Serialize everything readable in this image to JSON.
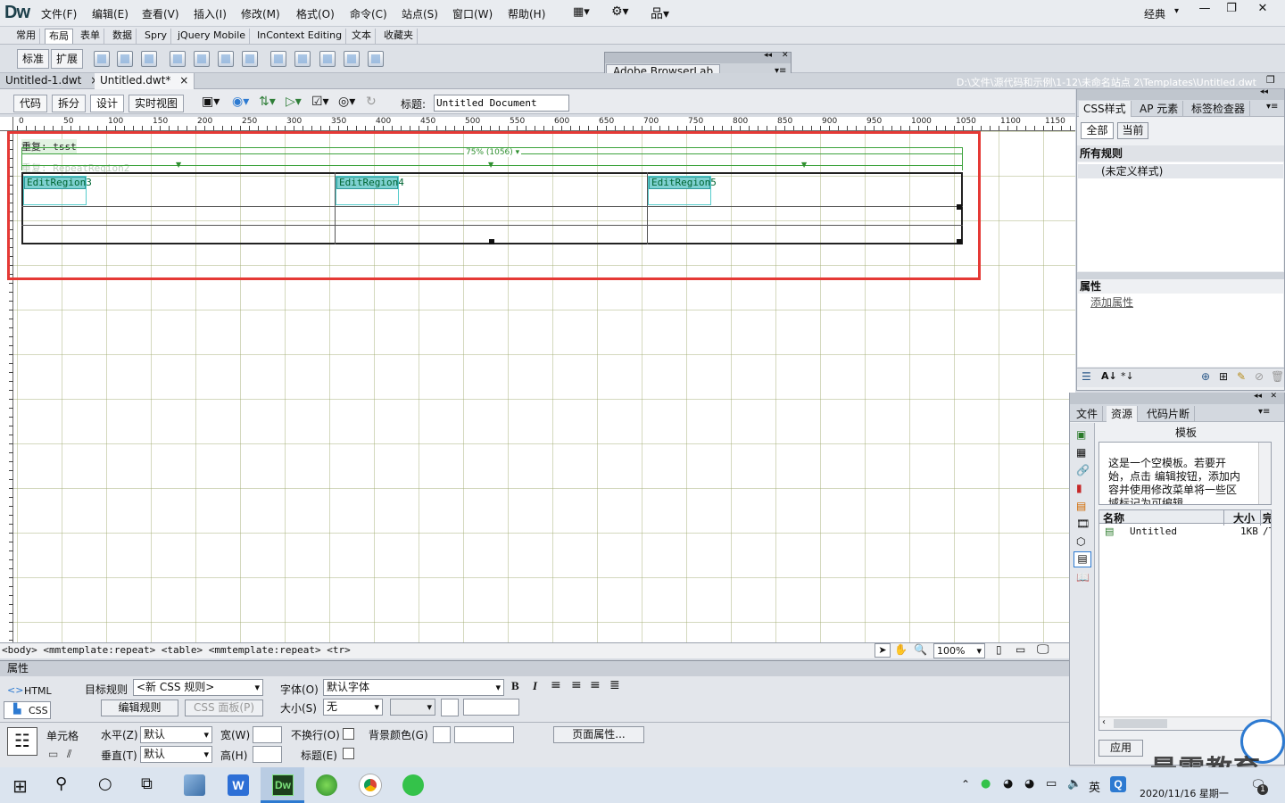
{
  "app": {
    "logo": "Dw",
    "workspace": "经典"
  },
  "menu": [
    "文件(F)",
    "编辑(E)",
    "查看(V)",
    "插入(I)",
    "修改(M)",
    "格式(O)",
    "命令(C)",
    "站点(S)",
    "窗口(W)",
    "帮助(H)"
  ],
  "insert_tabs": [
    "常用",
    "布局",
    "表单",
    "数据",
    "Spry",
    "jQuery Mobile",
    "InContext Editing",
    "文本",
    "收藏夹"
  ],
  "insert_active": "布局",
  "layout_buttons": {
    "standard": "标准",
    "expanded": "扩展"
  },
  "browserlab": "Adobe BrowserLab",
  "doc_tabs": [
    {
      "label": "Untitled-1.dwt",
      "close": "×"
    },
    {
      "label": "Untitled.dwt*",
      "close": "×"
    }
  ],
  "doc_path": "D:\\文件\\源代码和示例\\1-12\\未命名站点 2\\Templates\\Untitled.dwt",
  "view_buttons": [
    "代码",
    "拆分",
    "设计",
    "实时视图"
  ],
  "active_view": "设计",
  "title_label": "标题:",
  "title_value": "Untitled Document",
  "ruler_ticks": [
    "0",
    "50",
    "100",
    "150",
    "200",
    "250",
    "300",
    "350",
    "400",
    "450",
    "500",
    "550",
    "600",
    "650",
    "700",
    "750",
    "800",
    "850",
    "900",
    "950",
    "1000",
    "1050",
    "1100",
    "1150"
  ],
  "design": {
    "repeat_label": "重复: tsst",
    "repeat_region": "重复: RepeatRegion2",
    "width_label": "75% (1056) ▾",
    "edit_regions": [
      "EditRegion3",
      "EditRegion4",
      "EditRegion5"
    ]
  },
  "tag_selector": "<body> <mmtemplate:repeat> <table> <mmtemplate:repeat> <tr>",
  "zoom": "100%",
  "properties": {
    "header": "属性",
    "html": "HTML",
    "css": "CSS",
    "target_rule_label": "目标规则",
    "target_rule_value": "<新 CSS 规则>",
    "edit_rule": "编辑规则",
    "css_panel": "CSS 面板(P)",
    "font_label": "字体(O)",
    "font_value": "默认字体",
    "size_label": "大小(S)",
    "size_value": "无",
    "bold": "B",
    "italic": "I",
    "cell_label": "单元格",
    "horz_label": "水平(Z)",
    "horz_value": "默认",
    "vert_label": "垂直(T)",
    "vert_value": "默认",
    "width_label": "宽(W)",
    "height_label": "高(H)",
    "nowrap_label": "不换行(O)",
    "header_label": "标题(E)",
    "bg_label": "背景颜色(G)",
    "page_props": "页面属性..."
  },
  "css_panel": {
    "tabs": [
      "CSS样式",
      "AP 元素",
      "标签检查器"
    ],
    "all": "全部",
    "current": "当前",
    "all_rules": "所有规则",
    "undefined_style": "(未定义样式)",
    "props_title": "属性",
    "add_prop": "添加属性"
  },
  "assets_panel": {
    "tabs": [
      "文件",
      "资源",
      "代码片断"
    ],
    "title": "模板",
    "message": "这是一个空模板。若要开始，点击 编辑按钮，添加内容并使用修改菜单将一些区域标记为可编辑。",
    "col_name": "名称",
    "col_size": "大小",
    "col_path": "完",
    "item_name": "Untitled",
    "item_size": "1KB",
    "item_path": "/T",
    "apply": "应用"
  },
  "taskbar": {
    "ime": "英",
    "date": "2020/11/16 星期一",
    "notifications": "1"
  },
  "watermark": "最需教育",
  "colors": {
    "selection": "#e53935",
    "edit_region": "#7fd1d1",
    "grid": "#c8cba0",
    "accent": "#2d7ad1"
  }
}
